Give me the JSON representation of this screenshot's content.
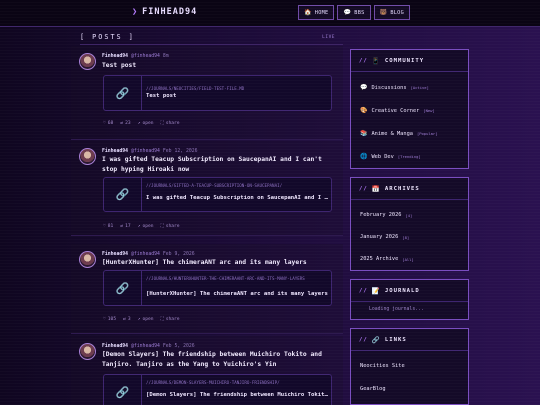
{
  "header": {
    "logo": "FINHEAD94",
    "nav": [
      {
        "label": "HOME",
        "icon": "house-icon",
        "glyph": "🏠"
      },
      {
        "label": "BBS",
        "icon": "speech-bubble-icon",
        "glyph": "💬"
      },
      {
        "label": "BLOG",
        "icon": "bear-icon",
        "glyph": "🐻"
      }
    ]
  },
  "posts": {
    "title": "[ POSTS ]",
    "live": "LIVE",
    "items": [
      {
        "author": "Finhead94",
        "handle": "@finhead94",
        "time": "8m",
        "text": "Test post",
        "link_url": "//journals/neocities/field-test-file.md",
        "link_title": "Test post",
        "likes": "68",
        "reposts": "23",
        "open": "open",
        "share": "share"
      },
      {
        "author": "Finhead94",
        "handle": "@finhead94",
        "time": "Feb 12, 2026",
        "text": "I was gifted Teacup Subscription on SaucepanAI and I can't stop hyping Hiroaki now",
        "link_url": "//journals/gifted-a-teacup-subscription-on-saucepanai/",
        "link_title": "I was gifted Teacup Subscription on SaucepanAI and I can't stop hyping Hiroaki now",
        "likes": "81",
        "reposts": "17",
        "open": "open",
        "share": "share"
      },
      {
        "author": "Finhead94",
        "handle": "@finhead94",
        "time": "Feb 9, 2026",
        "text": "[HunterXHunter] The chimeraANT arc and its many layers",
        "link_url": "//journals/hunterxhunter-the-chimeraant-arc-and-its-many-layers",
        "link_title": "[HunterXHunter] The chimeraANT arc and its many layers",
        "likes": "105",
        "reposts": "3",
        "open": "open",
        "share": "share"
      },
      {
        "author": "Finhead94",
        "handle": "@finhead94",
        "time": "Feb 5, 2026",
        "text": "[Demon Slayers] The friendship between Muichiro Tokito and Tanjiro. Tanjiro as the Yang to Yuichiro's Yin",
        "link_url": "//journals/demon-slayers-muichiro-tanjiro-friendship/",
        "link_title": "[Demon Slayers] The friendship between Muichiro Tokito and Tanjiro",
        "likes": "",
        "reposts": "",
        "open": "",
        "share": ""
      }
    ]
  },
  "sidebar": {
    "community": {
      "title": "COMMUNITY",
      "icon": "phone-icon",
      "glyph": "📱",
      "items": [
        {
          "label": "Discussions",
          "tag": "[Active]",
          "icon": "speech-bubble-icon",
          "glyph": "💬"
        },
        {
          "label": "Creative Corner",
          "tag": "[New]",
          "icon": "palette-icon",
          "glyph": "🎨"
        },
        {
          "label": "Anime & Manga",
          "tag": "[Popular]",
          "icon": "books-icon",
          "glyph": "📚"
        },
        {
          "label": "Web Dev",
          "tag": "[Trending]",
          "icon": "globe-icon",
          "glyph": "🌐"
        }
      ]
    },
    "archives": {
      "title": "ARCHIVES",
      "icon": "calendar-icon",
      "glyph": "📅",
      "items": [
        {
          "label": "February 2026",
          "count": "[4]"
        },
        {
          "label": "January 2026",
          "count": "[8]"
        },
        {
          "label": "2025 Archive",
          "count": "[All]"
        }
      ]
    },
    "journald": {
      "title": "JOURNALD",
      "icon": "memo-icon",
      "glyph": "📝",
      "loading": "Loading journals..."
    },
    "links": {
      "title": "LINKS",
      "icon": "link-icon",
      "glyph": "🔗",
      "items": [
        {
          "label": "Neocities Site"
        },
        {
          "label": "GearBlog"
        }
      ]
    }
  },
  "colors": {
    "accent": "#b57bff",
    "border": "#7a4ec0",
    "background": "#1c0b38"
  }
}
